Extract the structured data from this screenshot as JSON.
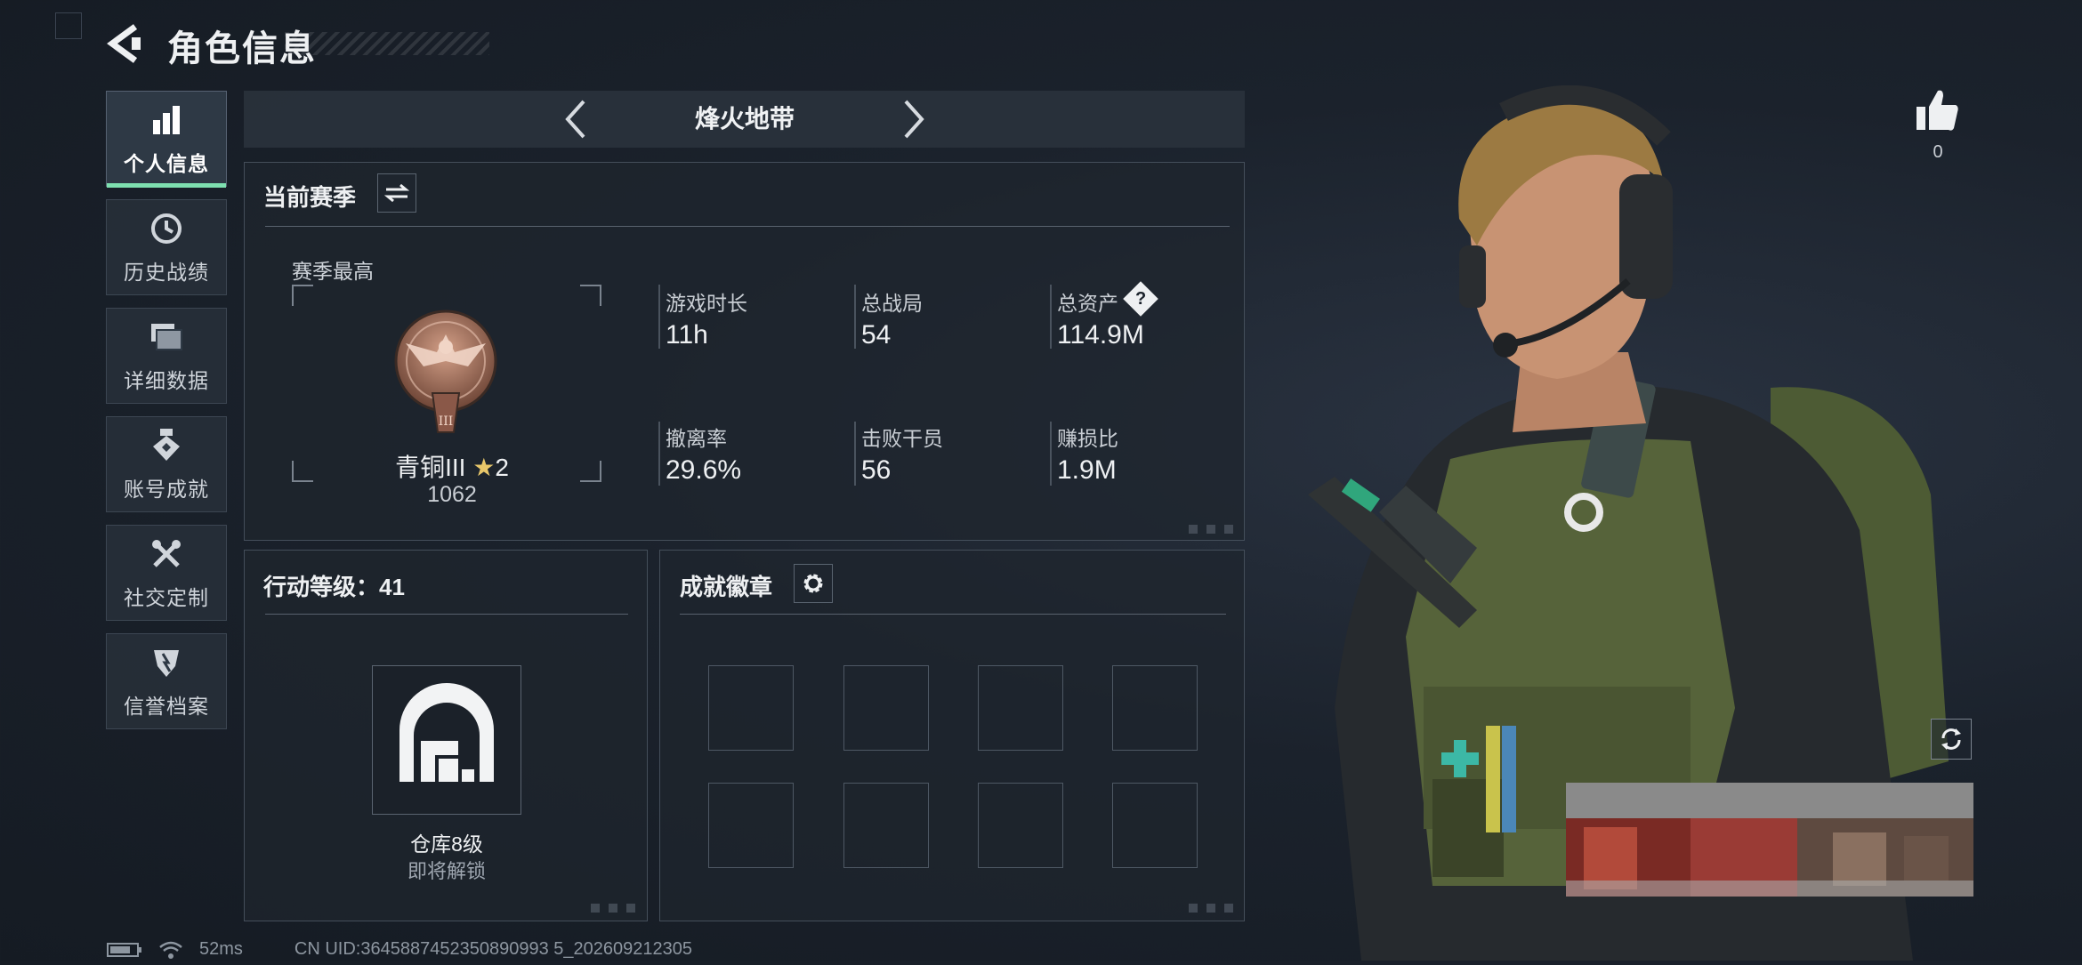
{
  "header": {
    "title": "角色信息"
  },
  "nav": {
    "items": [
      {
        "label": "个人信息",
        "icon": "bar-chart-icon",
        "active": true
      },
      {
        "label": "历史战绩",
        "icon": "history-clock-icon"
      },
      {
        "label": "详细数据",
        "icon": "folders-icon"
      },
      {
        "label": "账号成就",
        "icon": "medal-icon"
      },
      {
        "label": "社交定制",
        "icon": "tools-icon"
      },
      {
        "label": "信誉档案",
        "icon": "shield-icon"
      }
    ]
  },
  "mode": {
    "label": "烽火地带"
  },
  "season": {
    "title": "当前赛季",
    "best_label": "赛季最高",
    "rank_name": "青铜III",
    "rank_stars": "2",
    "rank_score": "1062",
    "stats": [
      {
        "label": "游戏时长",
        "value": "11h"
      },
      {
        "label": "总战局",
        "value": "54"
      },
      {
        "label": "总资产",
        "value": "114.9M",
        "help": "?"
      },
      {
        "label": "撤离率",
        "value": "29.6%"
      },
      {
        "label": "击败干员",
        "value": "56"
      },
      {
        "label": "赚损比",
        "value": "1.9M"
      }
    ]
  },
  "level": {
    "title": "行动等级：41",
    "warehouse_label": "仓库8级",
    "warehouse_sub": "即将解锁"
  },
  "achievements": {
    "title": "成就徽章"
  },
  "likes": {
    "count": "0"
  },
  "status": {
    "ping": "52ms",
    "uid": "CN UID:3645887452350890993 5_202609212305"
  },
  "colors": {
    "accent": "#7ee0b0",
    "panel_border": "#444e5a",
    "background": "#1b222c",
    "bronze": "#a8705a"
  }
}
